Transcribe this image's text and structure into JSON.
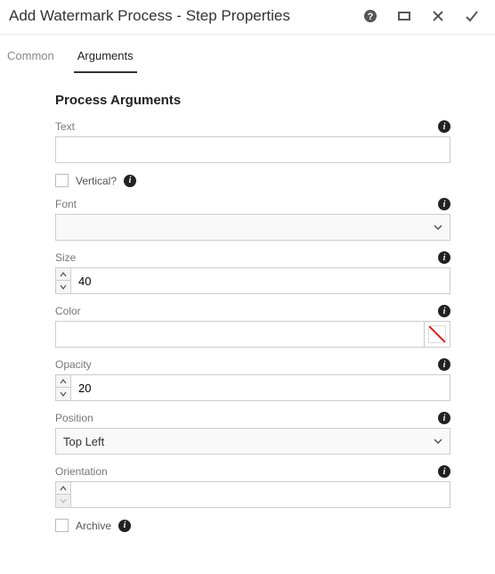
{
  "header": {
    "title": "Add Watermark Process - Step Properties"
  },
  "tabs": {
    "common": "Common",
    "arguments": "Arguments"
  },
  "section": {
    "title": "Process Arguments"
  },
  "fields": {
    "text": {
      "label": "Text",
      "value": ""
    },
    "vertical": {
      "label": "Vertical?"
    },
    "font": {
      "label": "Font",
      "value": ""
    },
    "size": {
      "label": "Size",
      "value": "40"
    },
    "color": {
      "label": "Color"
    },
    "opacity": {
      "label": "Opacity",
      "value": "20"
    },
    "position": {
      "label": "Position",
      "value": "Top Left"
    },
    "orientation": {
      "label": "Orientation",
      "value": ""
    },
    "archive": {
      "label": "Archive"
    }
  }
}
